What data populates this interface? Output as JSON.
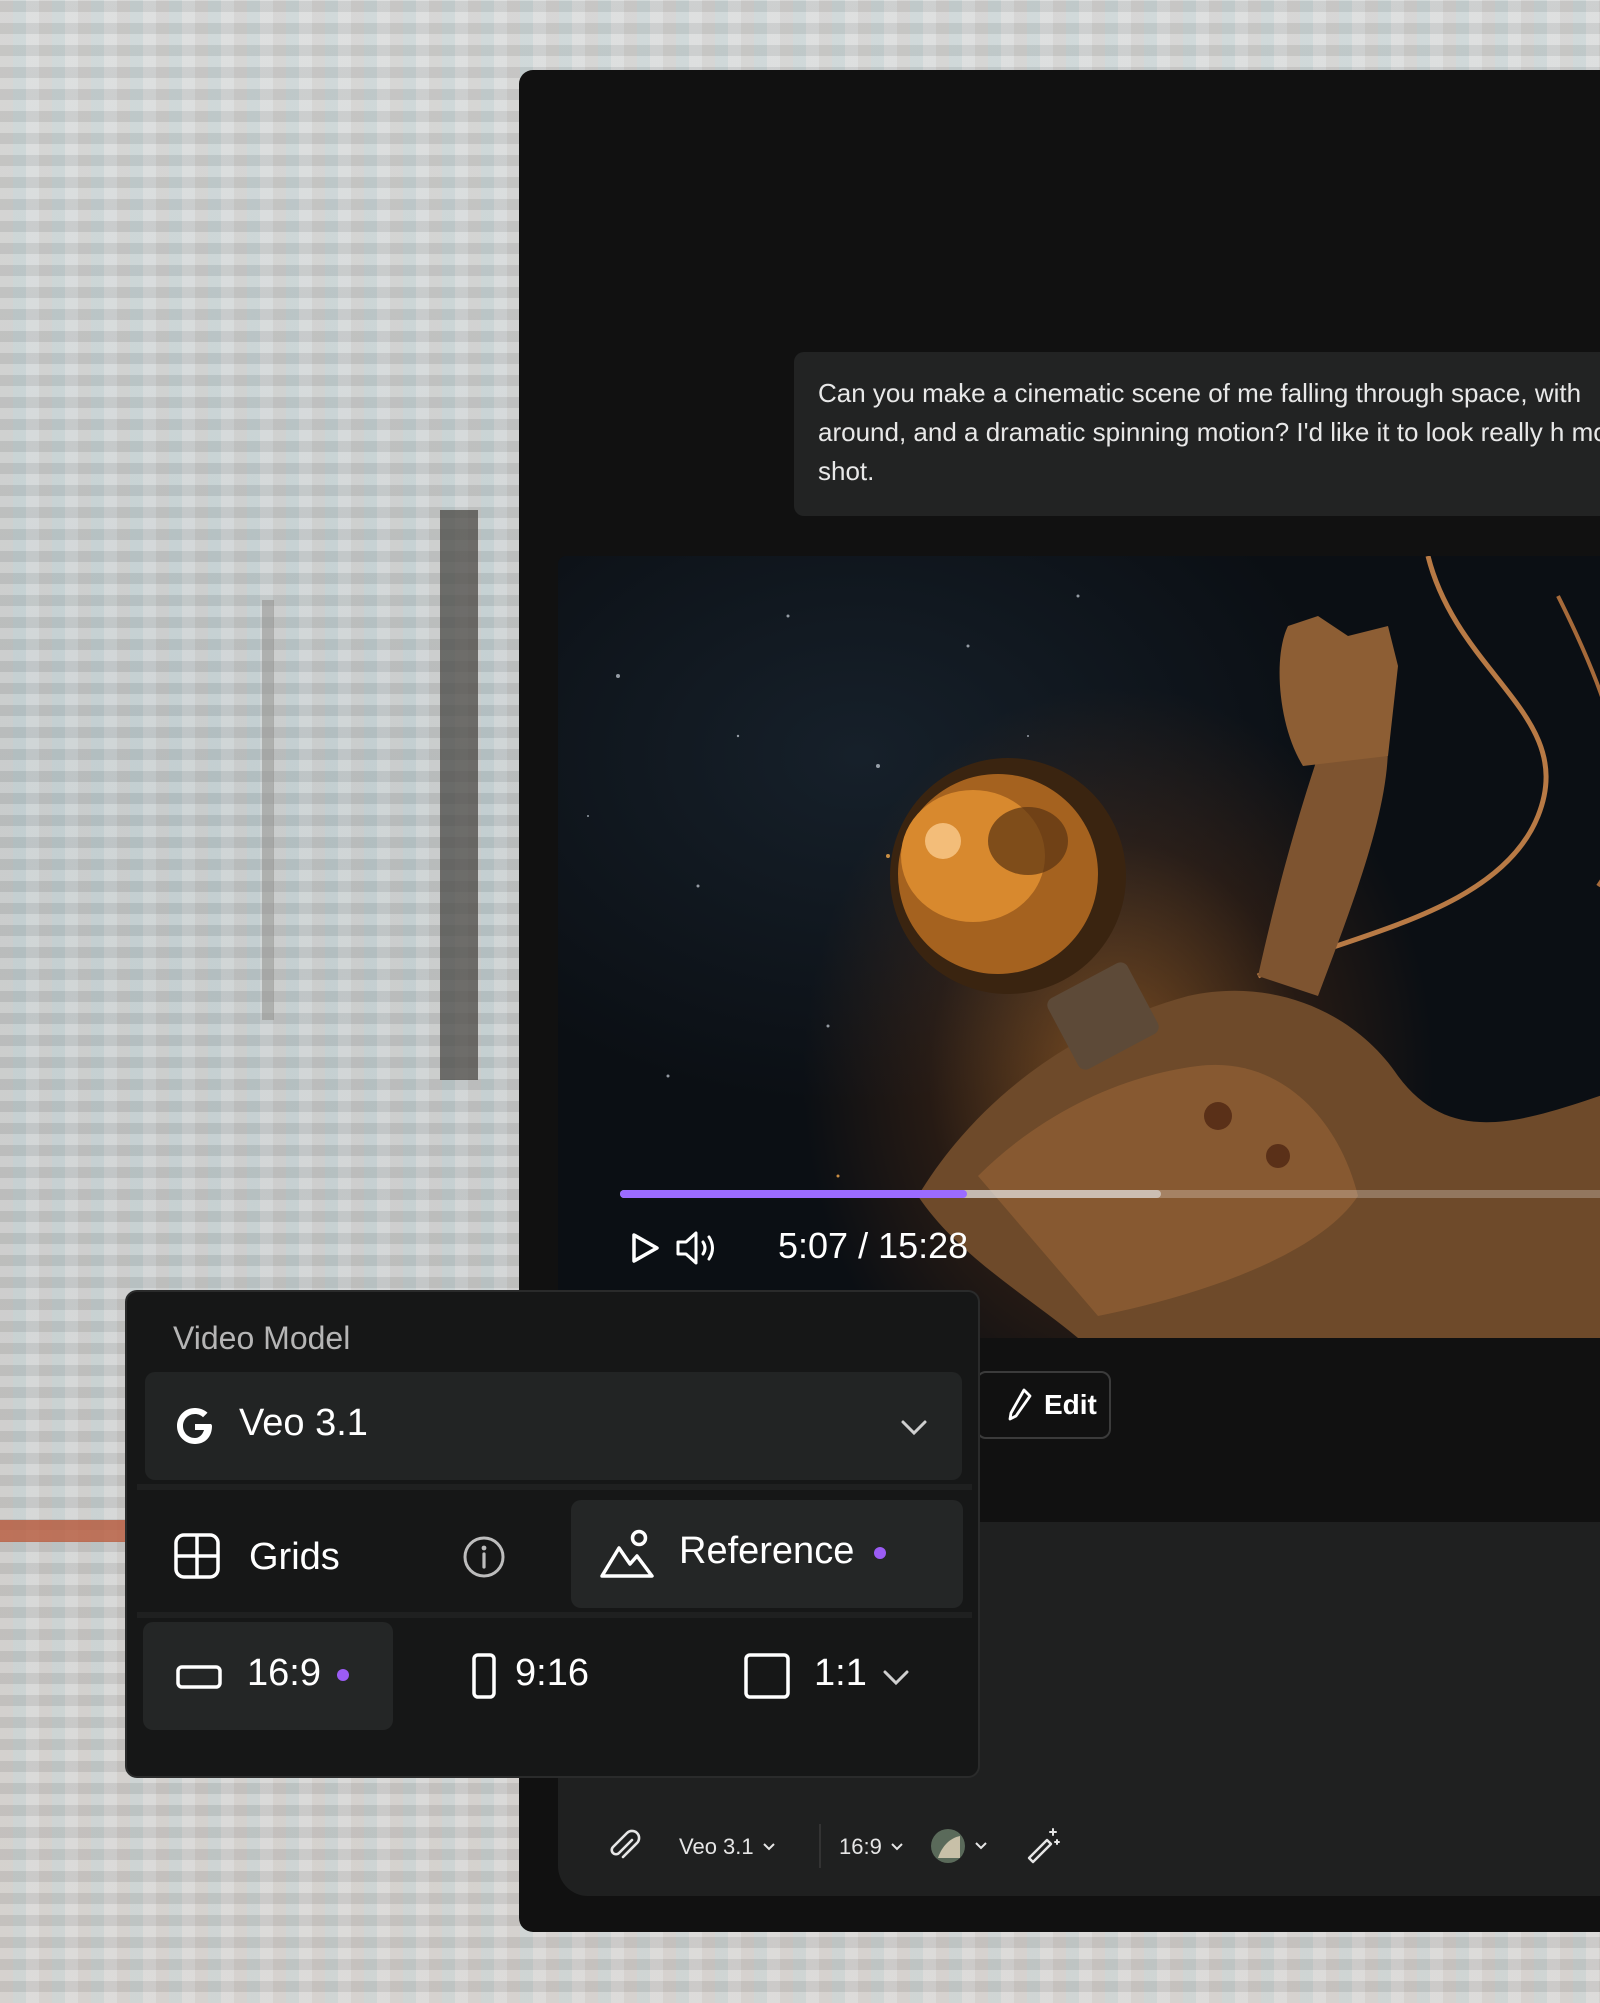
{
  "chat": {
    "user_message": "Can you make a cinematic scene of me falling through space, with around, and a dramatic spinning motion? I'd like it to look really h movie shot."
  },
  "video": {
    "current_time": "5:07",
    "duration": "15:28",
    "time_text": "5:07 / 15:28",
    "progress_fraction": 0.33,
    "buffered_fraction": 0.515
  },
  "actions": {
    "edit_label": "Edit"
  },
  "composer": {
    "model_label": "Veo 3.1",
    "ratio_label": "16:9"
  },
  "popover": {
    "title": "Video Model",
    "model_name": "Veo 3.1",
    "grids_label": "Grids",
    "reference_label": "Reference",
    "ratios": [
      "16:9",
      "9:16",
      "1:1"
    ],
    "selected_ratio": "16:9"
  },
  "colors": {
    "accent": "#9b6bff",
    "dot": "#9b5cf4",
    "app_bg": "#111111",
    "panel_bg": "#161717"
  },
  "icons": [
    "play-icon",
    "volume-icon",
    "edit-pen-icon",
    "paperclip-icon",
    "chevron-down-icon",
    "magic-wand-icon",
    "google-icon",
    "grid-icon",
    "info-icon",
    "image-mountain-icon",
    "landscape-icon",
    "portrait-icon",
    "square-icon"
  ]
}
